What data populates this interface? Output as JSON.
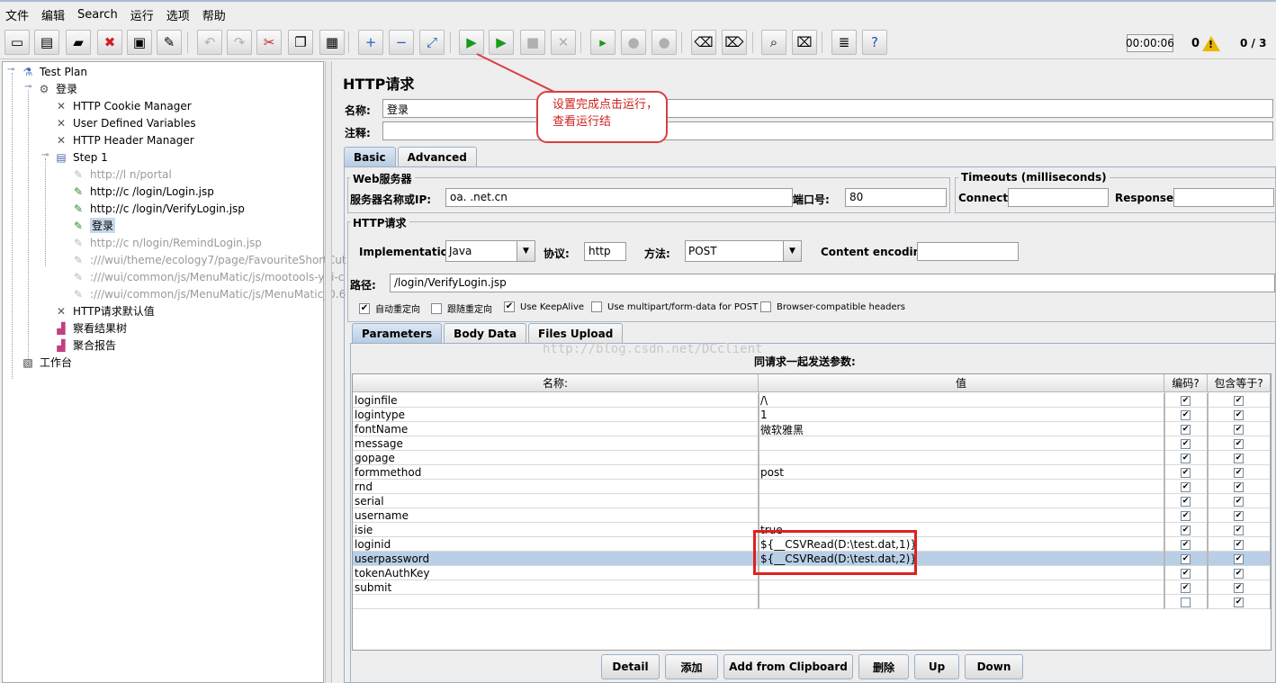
{
  "menu": [
    "文件",
    "编辑",
    "Search",
    "运行",
    "选项",
    "帮助"
  ],
  "toolbar": {
    "icons": [
      "new-file-icon",
      "templates-icon",
      "open-icon",
      "close-icon",
      "save-icon",
      "save-as-icon",
      "undo-icon",
      "redo-icon",
      "cut-icon",
      "copy-icon",
      "paste-icon",
      "expand-icon",
      "collapse-icon",
      "toggle-icon",
      "start-icon",
      "start-no-pause-icon",
      "stop-icon",
      "shutdown-icon",
      "remote-start-icon",
      "remote-stop-icon",
      "remote-shutdown-icon",
      "clear-icon",
      "clear-all-icon",
      "search-icon",
      "reset-search-icon",
      "function-helper-icon",
      "help-icon"
    ],
    "timer": "00:00:06",
    "error_count": "0",
    "threads": "0 / 3"
  },
  "tree": [
    {
      "label": "Test Plan",
      "icon": "flask-icon",
      "level": 0,
      "state": "normal"
    },
    {
      "label": "登录",
      "icon": "thread-group-icon",
      "level": 1,
      "state": "normal"
    },
    {
      "label": "HTTP Cookie Manager",
      "icon": "config-element-icon",
      "level": 2,
      "state": "normal"
    },
    {
      "label": "User Defined Variables",
      "icon": "config-element-icon",
      "level": 2,
      "state": "normal"
    },
    {
      "label": "HTTP Header Manager",
      "icon": "config-element-icon",
      "level": 2,
      "state": "normal"
    },
    {
      "label": "Step 1",
      "icon": "controller-icon",
      "level": 2,
      "state": "normal"
    },
    {
      "label": "http://l                          n/portal",
      "icon": "sampler-icon",
      "level": 3,
      "state": "disabled"
    },
    {
      "label": "http://c                  /login/Login.jsp",
      "icon": "sampler-icon",
      "level": 3,
      "state": "normal"
    },
    {
      "label": "http://c                   /login/VerifyLogin.jsp",
      "icon": "sampler-icon",
      "level": 3,
      "state": "normal"
    },
    {
      "label": "登录",
      "icon": "sampler-icon",
      "level": 3,
      "state": "selected"
    },
    {
      "label": "http://c                  n/login/RemindLogin.jsp",
      "icon": "sampler-icon",
      "level": 3,
      "state": "disabled"
    },
    {
      "label": ":///wui/theme/ecology7/page/FavouriteShortCut",
      "icon": "sampler-icon",
      "level": 3,
      "state": "disabled"
    },
    {
      "label": ":///wui/common/js/MenuMatic/js/mootools-yui-c",
      "icon": "sampler-icon",
      "level": 3,
      "state": "disabled"
    },
    {
      "label": ":///wui/common/js/MenuMatic/js/MenuMatic_0.6",
      "icon": "sampler-icon",
      "level": 3,
      "state": "disabled"
    },
    {
      "label": "HTTP请求默认值",
      "icon": "config-element-icon",
      "level": 2,
      "state": "normal"
    },
    {
      "label": "察看结果树",
      "icon": "listener-icon",
      "level": 2,
      "state": "normal"
    },
    {
      "label": "聚合报告",
      "icon": "listener-icon",
      "level": 2,
      "state": "normal"
    },
    {
      "label": "工作台",
      "icon": "workbench-icon",
      "level": 0,
      "state": "normal"
    }
  ],
  "panel": {
    "title": "HTTP请求",
    "name_label": "名称:",
    "name_value": "登录",
    "comment_label": "注释:",
    "comment_value": "",
    "tabs": [
      "Basic",
      "Advanced"
    ],
    "web_server": {
      "legend": "Web服务器",
      "server_label": "服务器名称或IP:",
      "server_value": "oa.          .net.cn",
      "port_label": "端口号:",
      "port_value": "80"
    },
    "timeouts": {
      "legend": "Timeouts (milliseconds)",
      "connect_label": "Connect:",
      "connect_value": "",
      "response_label": "Response:",
      "response_value": ""
    },
    "http_request": {
      "legend": "HTTP请求",
      "impl_label": "Implementation:",
      "impl_value": "Java",
      "protocol_label": "协议:",
      "protocol_value": "http",
      "method_label": "方法:",
      "method_value": "POST",
      "encoding_label": "Content encoding:",
      "encoding_value": "",
      "path_label": "路径:",
      "path_value": "/login/VerifyLogin.jsp"
    },
    "options": [
      {
        "label": "自动重定向",
        "checked": true
      },
      {
        "label": "跟随重定向",
        "checked": false
      },
      {
        "label": "Use KeepAlive",
        "checked": true
      },
      {
        "label": "Use multipart/form-data for POST",
        "checked": false
      },
      {
        "label": "Browser-compatible headers",
        "checked": false
      }
    ],
    "sub_tabs": [
      "Parameters",
      "Body Data",
      "Files Upload"
    ],
    "watermark": "http://blog.csdn.net/DCclient",
    "params_caption": "同请求一起发送参数:",
    "columns": [
      "名称:",
      "值",
      "编码?",
      "包含等于?"
    ],
    "rows": [
      {
        "name": "loginfile",
        "value": "/\\",
        "encode": true,
        "include_equals": true
      },
      {
        "name": "logintype",
        "value": "1",
        "encode": true,
        "include_equals": true
      },
      {
        "name": "fontName",
        "value": "微软雅黑",
        "encode": true,
        "include_equals": true
      },
      {
        "name": "message",
        "value": "",
        "encode": true,
        "include_equals": true
      },
      {
        "name": "gopage",
        "value": "",
        "encode": true,
        "include_equals": true
      },
      {
        "name": "formmethod",
        "value": "post",
        "encode": true,
        "include_equals": true
      },
      {
        "name": "rnd",
        "value": "",
        "encode": true,
        "include_equals": true
      },
      {
        "name": "serial",
        "value": "",
        "encode": true,
        "include_equals": true
      },
      {
        "name": "username",
        "value": "",
        "encode": true,
        "include_equals": true
      },
      {
        "name": "isie",
        "value": "true",
        "encode": true,
        "include_equals": true
      },
      {
        "name": "loginid",
        "value": "${__CSVRead(D:\\test.dat,1)}",
        "encode": true,
        "include_equals": true
      },
      {
        "name": "userpassword",
        "value": "${__CSVRead(D:\\test.dat,2)}",
        "encode": true,
        "include_equals": true
      },
      {
        "name": "tokenAuthKey",
        "value": "",
        "encode": true,
        "include_equals": true
      },
      {
        "name": "submit",
        "value": "",
        "encode": true,
        "include_equals": true
      },
      {
        "name": "",
        "value": "",
        "encode": false,
        "include_equals": true
      }
    ],
    "selected_row": 11,
    "buttons": [
      "Detail",
      "添加",
      "Add from Clipboard",
      "删除",
      "Up",
      "Down"
    ]
  },
  "annotation": {
    "callout_text": "设置完成点击运行，查看运行结",
    "accent": "#d94040"
  }
}
